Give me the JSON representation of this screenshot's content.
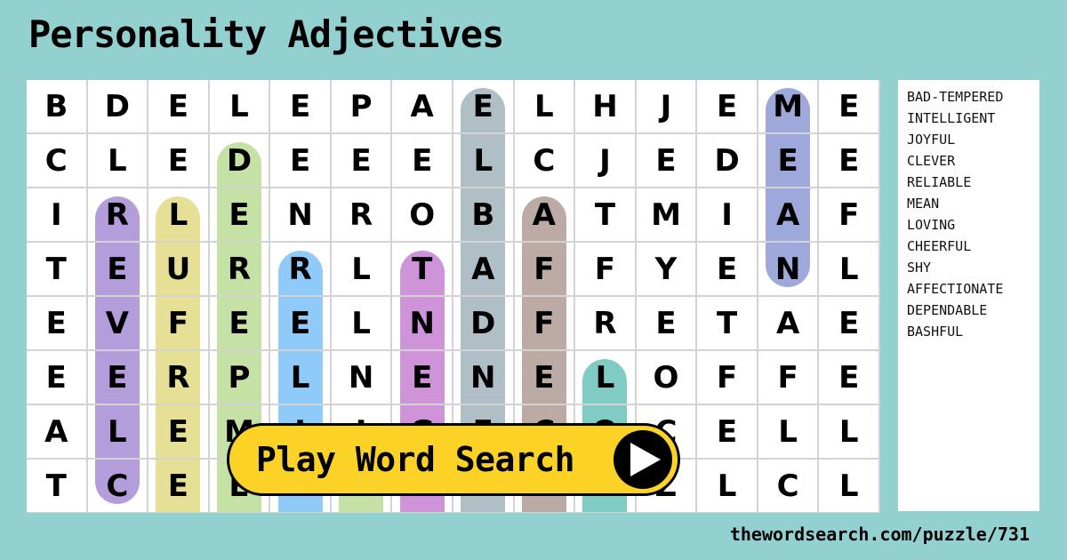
{
  "title": "Personality Adjectives",
  "grid": {
    "rows": [
      [
        "B",
        "D",
        "E",
        "L",
        "E",
        "P",
        "A",
        "E",
        "L",
        "H",
        "J",
        "E",
        "M",
        "E"
      ],
      [
        "C",
        "L",
        "E",
        "D",
        "E",
        "E",
        "E",
        "L",
        "C",
        "J",
        "E",
        "D",
        "E",
        "E"
      ],
      [
        "I",
        "R",
        "L",
        "E",
        "N",
        "R",
        "O",
        "B",
        "A",
        "T",
        "M",
        "I",
        "A",
        "F"
      ],
      [
        "T",
        "E",
        "U",
        "R",
        "R",
        "L",
        "T",
        "A",
        "F",
        "F",
        "Y",
        "E",
        "N",
        "L"
      ],
      [
        "E",
        "V",
        "F",
        "E",
        "E",
        "L",
        "N",
        "D",
        "F",
        "R",
        "E",
        "T",
        "A",
        "E"
      ],
      [
        "E",
        "E",
        "R",
        "P",
        "L",
        "N",
        "E",
        "N",
        "E",
        "L",
        "O",
        "F",
        "F",
        "E"
      ],
      [
        "A",
        "L",
        "E",
        "M",
        "I",
        "I",
        "G",
        "E",
        "C",
        "O",
        "C",
        "E",
        "L",
        "L"
      ],
      [
        "T",
        "C",
        "E",
        "E",
        "A",
        "E",
        "I",
        "P",
        "T",
        "V",
        "Z",
        "L",
        "C",
        "L"
      ]
    ],
    "highlights": [
      {
        "word": "CLEVER",
        "col": 1,
        "row_start": 2,
        "row_end": 7,
        "color": "#b39ddb",
        "continues_below": false
      },
      {
        "word": "CHEERFUL",
        "col": 2,
        "row_start": 2,
        "row_end": 7,
        "color": "#e6df96",
        "continues_below": true
      },
      {
        "word": "BAD-TEMPERED",
        "col": 3,
        "row_start": 1,
        "row_end": 7,
        "color": "#c5e1a5",
        "continues_below": true
      },
      {
        "word": "RELIABLE",
        "col": 4,
        "row_start": 3,
        "row_end": 7,
        "color": "#90caf9",
        "continues_below": true
      },
      {
        "word": "SHY",
        "col": 5,
        "row_start": 7,
        "row_end": 7,
        "color": "#c5e1a5",
        "continues_below": true
      },
      {
        "word": "INTELLIGENT",
        "col": 6,
        "row_start": 3,
        "row_end": 7,
        "color": "#ce93d8",
        "continues_below": true
      },
      {
        "word": "DEPENDABLE",
        "col": 7,
        "row_start": 0,
        "row_end": 7,
        "color": "#b0bec5",
        "continues_below": true
      },
      {
        "word": "AFFECTIONATE",
        "col": 8,
        "row_start": 2,
        "row_end": 7,
        "color": "#bcaaa4",
        "continues_below": true
      },
      {
        "word": "LOVING",
        "col": 9,
        "row_start": 5,
        "row_end": 7,
        "color": "#80cbc4",
        "continues_below": true
      },
      {
        "word": "MEAN",
        "col": 12,
        "row_start": 0,
        "row_end": 3,
        "color": "#9fa8da",
        "continues_below": false
      }
    ]
  },
  "word_list": [
    "BAD-TEMPERED",
    "INTELLIGENT",
    "JOYFUL",
    "CLEVER",
    "RELIABLE",
    "MEAN",
    "LOVING",
    "CHEERFUL",
    "SHY",
    "AFFECTIONATE",
    "DEPENDABLE",
    "BASHFUL"
  ],
  "play_button": {
    "label": "Play Word Search",
    "icon": "play-icon"
  },
  "footer": {
    "url": "thewordsearch.com/puzzle/731"
  },
  "colors": {
    "background": "#93d1d1",
    "button": "#fdd226"
  }
}
